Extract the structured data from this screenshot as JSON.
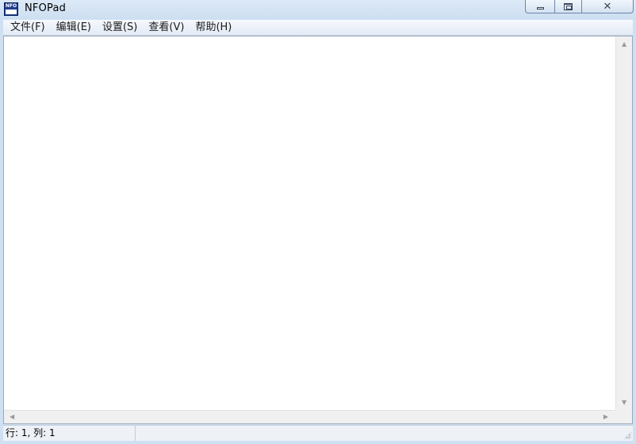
{
  "window": {
    "title": "NFOPad",
    "icon": "nfo-app-icon",
    "icon_text": "NFO",
    "controls": {
      "minimize": "minimize-icon",
      "maximize": "maximize-icon",
      "close": "close-icon"
    }
  },
  "menu": {
    "items": [
      {
        "label": "文件(F)"
      },
      {
        "label": "编辑(E)"
      },
      {
        "label": "设置(S)"
      },
      {
        "label": "查看(V)"
      },
      {
        "label": "帮助(H)"
      }
    ]
  },
  "editor": {
    "content": ""
  },
  "scrollbars": {
    "up": "▲",
    "down": "▼",
    "left": "◀",
    "right": "▶"
  },
  "status": {
    "position": "行: 1, 列: 1"
  },
  "colors": {
    "frame": "#cfe0f3",
    "menubar": "#e3ebf6",
    "editor_bg": "#ffffff",
    "statusbar": "#eef2f7"
  }
}
